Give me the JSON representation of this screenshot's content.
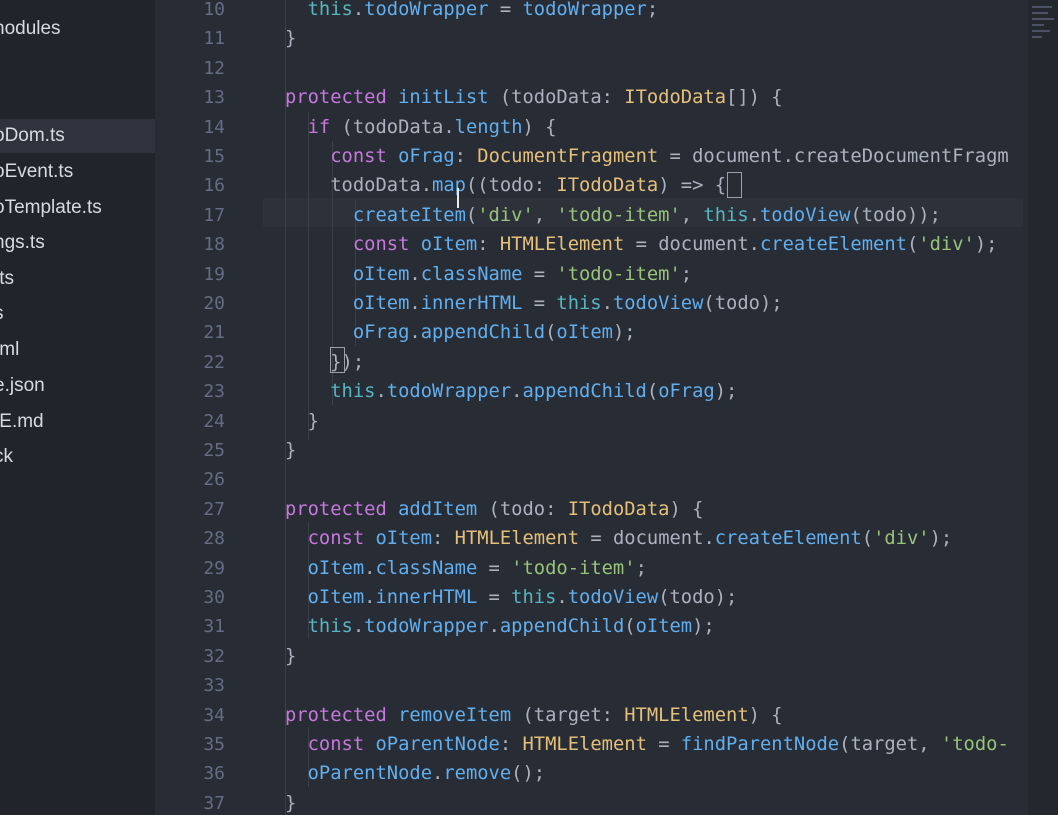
{
  "sidebar": {
    "items": [
      {
        "label": "node_modules",
        "shown": "nodules"
      },
      {
        "label": "todoDom.ts",
        "shown": "oDom.ts",
        "active": true
      },
      {
        "label": "todoEvent.ts",
        "shown": "oEvent.ts"
      },
      {
        "label": "todoTemplate.ts",
        "shown": "oTemplate.ts"
      },
      {
        "label": "settings.ts",
        "shown": "ngs.ts"
      },
      {
        "label": ".ts",
        "shown": ".ts"
      },
      {
        "label": "s",
        "shown": "s"
      },
      {
        "label": "tml",
        "shown": "tml"
      },
      {
        "label": "e.json",
        "shown": "e.json"
      },
      {
        "label": "IE.md",
        "shown": "IE.md"
      },
      {
        "label": "ck",
        "shown": "ck"
      }
    ]
  },
  "editor": {
    "line_numbers": [
      "10",
      "11",
      "12",
      "13",
      "14",
      "15",
      "16",
      "17",
      "18",
      "19",
      "20",
      "21",
      "22",
      "23",
      "24",
      "25",
      "26",
      "27",
      "28",
      "29",
      "30",
      "31",
      "32",
      "33",
      "34",
      "35",
      "36",
      "37"
    ],
    "lines": [
      "  this.todoWrapper = todoWrapper;",
      "}",
      "",
      "protected initList (todoData: ITodoData[]) {",
      "  if (todoData.length) {",
      "    const oFrag: DocumentFragment = document.createDocumentFragm",
      "    todoData.map((todo: ITodoData) => {",
      "      createItem('div', 'todo-item', this.todoView(todo));",
      "      const oItem: HTMLElement = document.createElement('div');",
      "      oItem.className = 'todo-item';",
      "      oItem.innerHTML = this.todoView(todo);",
      "      oFrag.appendChild(oItem);",
      "    });",
      "    this.todoWrapper.appendChild(oFrag);",
      "  }",
      "}",
      "",
      "protected addItem (todo: ITodoData) {",
      "  const oItem: HTMLElement = document.createElement('div');",
      "  oItem.className = 'todo-item';",
      "  oItem.innerHTML = this.todoView(todo);",
      "  this.todoWrapper.appendChild(oItem);",
      "}",
      "",
      "protected removeItem (target: HTMLElement) {",
      "  const oParentNode: HTMLElement = findParentNode(target, 'todo-",
      "  oParentNode.remove();",
      "}"
    ]
  },
  "colors": {
    "keyword": "#c678dd",
    "function": "#61afef",
    "type": "#e5c07b",
    "string": "#98c379",
    "this": "#56b6c2",
    "line_number": "#636d83"
  }
}
